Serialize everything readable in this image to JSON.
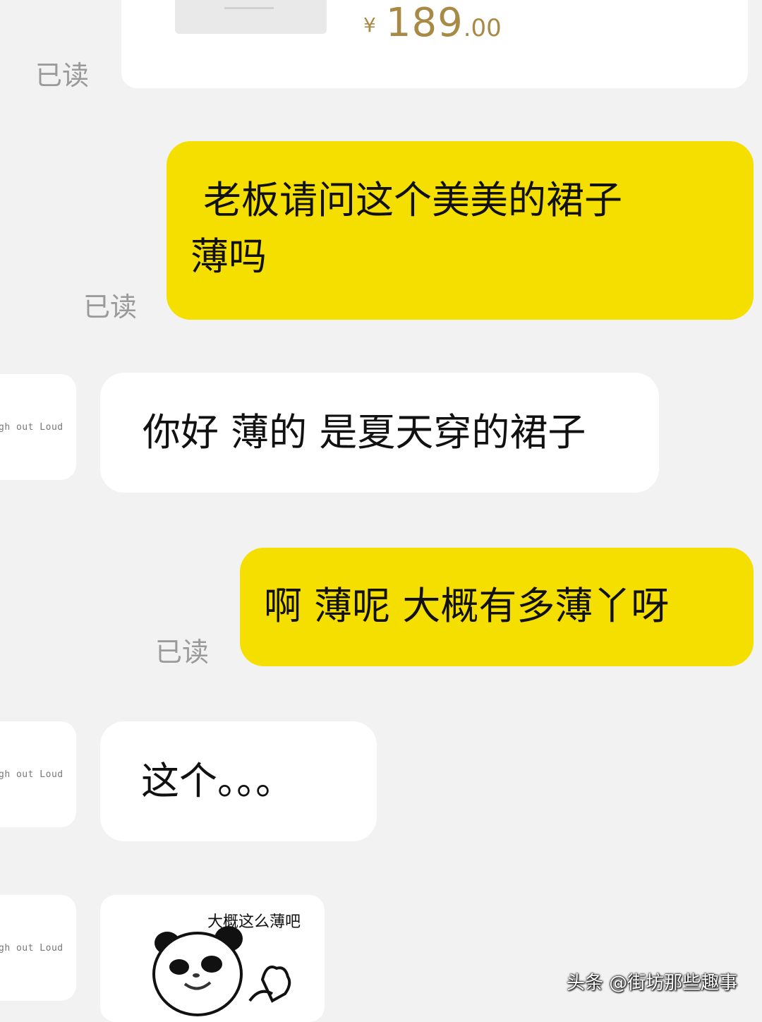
{
  "product": {
    "currency": "¥",
    "price_integer": "189",
    "price_decimal": ".00",
    "read_label": "已读"
  },
  "messages": [
    {
      "direction": "out",
      "line1": "老板请问这个美美的裙子",
      "line2": "薄吗",
      "read_label": "已读"
    },
    {
      "direction": "in",
      "avatar_text": "gh out Loud",
      "text": "你好 薄的 是夏天穿的裙子"
    },
    {
      "direction": "out",
      "text": "啊 薄呢 大概有多薄丫呀",
      "read_label": "已读"
    },
    {
      "direction": "in",
      "avatar_text": "gh out Loud",
      "text": "这个。。。"
    },
    {
      "direction": "in",
      "avatar_text": "gh out Loud",
      "sticker_caption": "大概这么薄吧"
    }
  ],
  "watermark": "头条 @街坊那些趣事",
  "colors": {
    "background": "#f2f2f2",
    "outgoing_bubble": "#f5df00",
    "incoming_bubble": "#ffffff",
    "read_label": "#9a9a9a",
    "price": "#a88945"
  },
  "icons": [
    "panda-meme-sticker"
  ]
}
